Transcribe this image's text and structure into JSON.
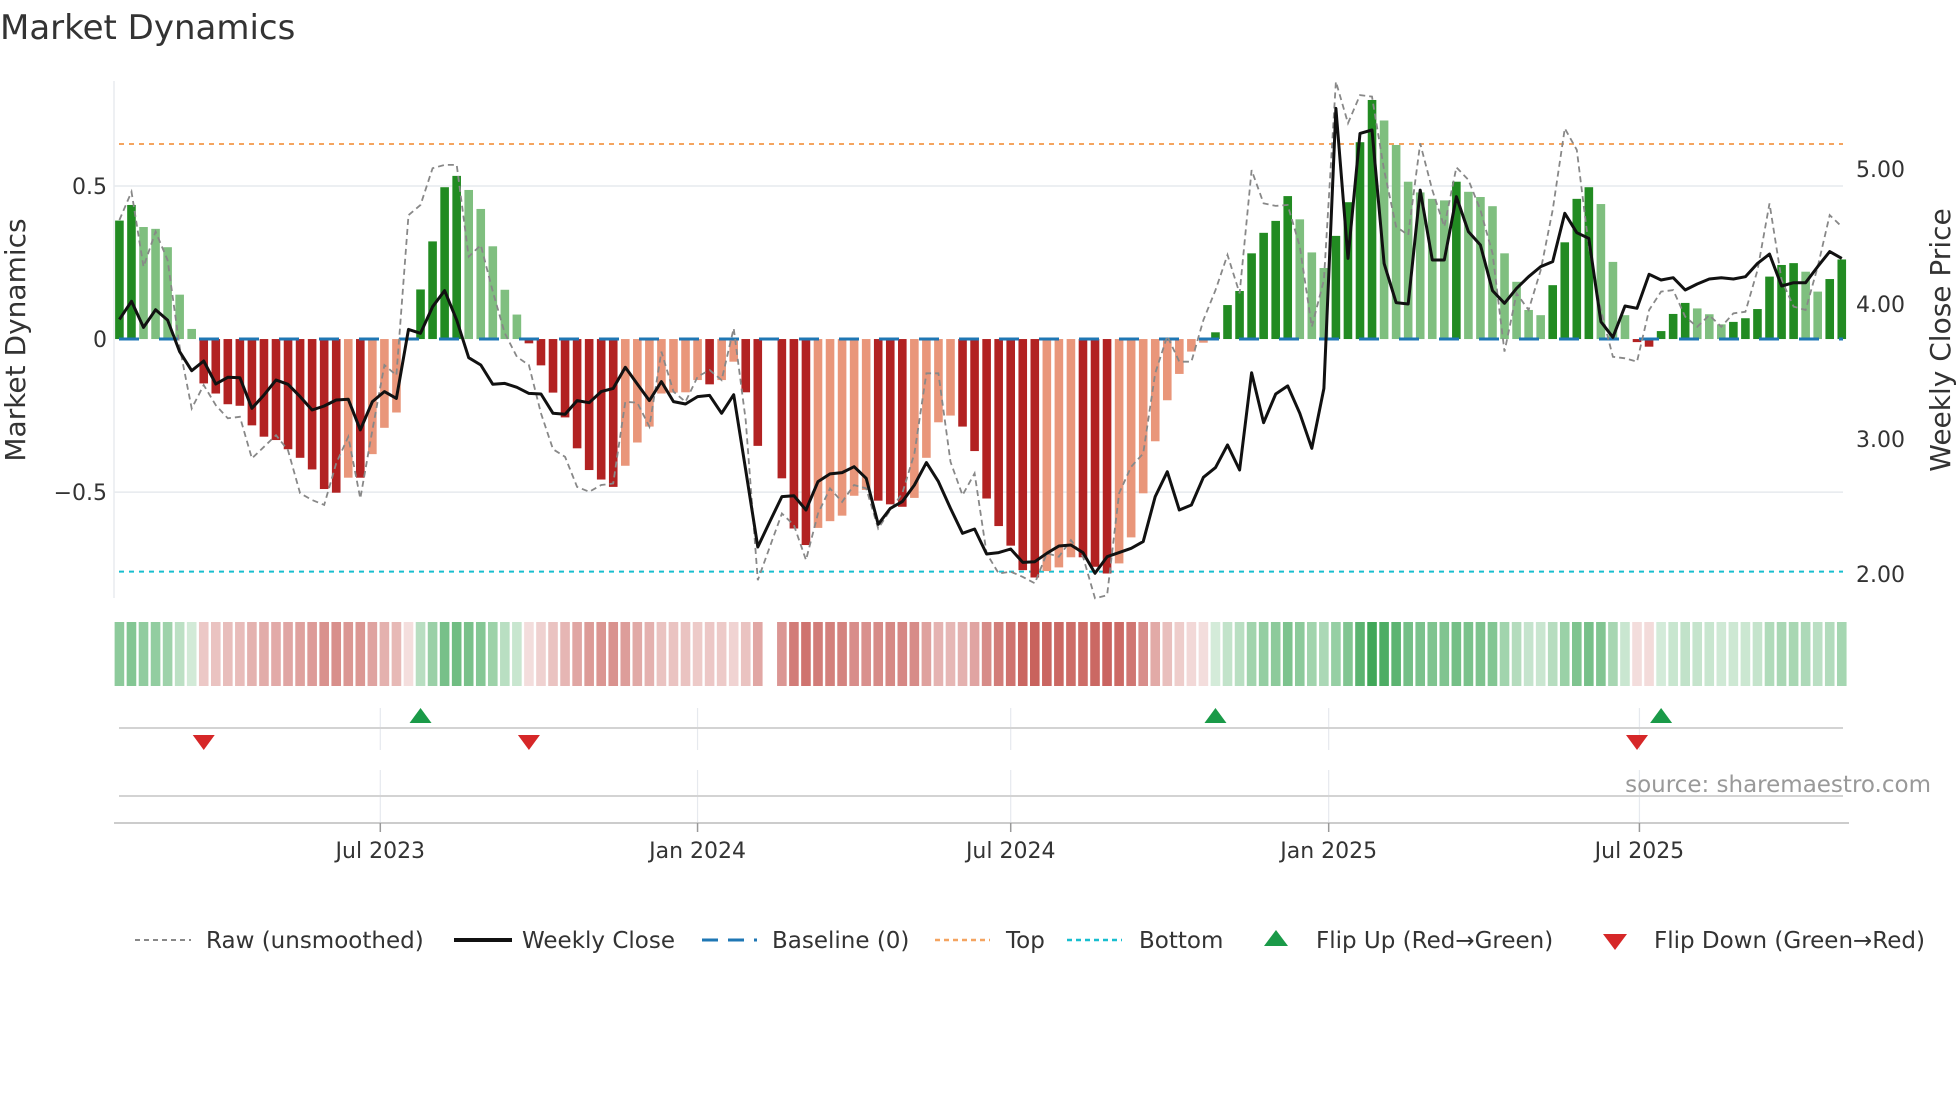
{
  "chart_data": {
    "type": "bar",
    "title": "Market Dynamics",
    "ylabel": "Market Dynamics",
    "ylabel_right": "Weekly Close Price",
    "ylim": [
      -0.846,
      0.843
    ],
    "ylim_right": [
      1.822,
      5.652
    ],
    "xlim_index": [
      -0.45,
      143.6
    ],
    "grid": true,
    "yticks": [
      {
        "v": 0.5,
        "label": "0.5"
      },
      {
        "v": 0,
        "label": "0"
      },
      {
        "v": -0.5,
        "label": "−0.5"
      }
    ],
    "yticks_right": [
      {
        "v": 5,
        "label": "5.00"
      },
      {
        "v": 4,
        "label": "4.00"
      },
      {
        "v": 3,
        "label": "3.00"
      },
      {
        "v": 2,
        "label": "2.00"
      }
    ],
    "xticks": [
      {
        "i": 21.66,
        "label": "Jul 2023"
      },
      {
        "i": 48.0,
        "label": "Jan 2024"
      },
      {
        "i": 74.0,
        "label": "Jul 2024"
      },
      {
        "i": 100.4,
        "label": "Jan 2025"
      },
      {
        "i": 126.2,
        "label": "Jul 2025"
      }
    ],
    "top_level": 0.637,
    "bottom_level": -0.76,
    "baseline": 0,
    "dynamics": [
      0.387,
      0.438,
      0.366,
      0.36,
      0.3,
      0.145,
      0.033,
      -0.145,
      -0.178,
      -0.213,
      -0.218,
      -0.282,
      -0.319,
      -0.33,
      -0.36,
      -0.388,
      -0.426,
      -0.49,
      -0.502,
      -0.453,
      -0.453,
      -0.376,
      -0.29,
      -0.24,
      -0.004,
      0.162,
      0.319,
      0.496,
      0.533,
      0.487,
      0.425,
      0.303,
      0.161,
      0.08,
      -0.014,
      -0.086,
      -0.175,
      -0.256,
      -0.357,
      -0.428,
      -0.459,
      -0.483,
      -0.414,
      -0.338,
      -0.286,
      -0.178,
      -0.175,
      -0.174,
      -0.134,
      -0.148,
      -0.134,
      -0.074,
      -0.174,
      -0.349,
      null,
      -0.455,
      -0.619,
      -0.673,
      -0.617,
      -0.595,
      -0.577,
      -0.512,
      -0.493,
      -0.528,
      -0.54,
      -0.548,
      -0.519,
      -0.388,
      -0.272,
      -0.25,
      -0.286,
      -0.366,
      -0.521,
      -0.611,
      -0.675,
      -0.755,
      -0.779,
      -0.758,
      -0.746,
      -0.713,
      -0.713,
      -0.744,
      -0.766,
      -0.733,
      -0.648,
      -0.504,
      -0.334,
      -0.2,
      -0.114,
      -0.041,
      -0.012,
      0.022,
      0.111,
      0.157,
      0.28,
      0.347,
      0.386,
      0.467,
      0.391,
      0.283,
      0.232,
      0.337,
      0.447,
      0.643,
      0.781,
      0.714,
      0.634,
      0.514,
      0.479,
      0.458,
      0.453,
      0.514,
      0.481,
      0.464,
      0.434,
      0.28,
      0.187,
      0.095,
      0.078,
      0.176,
      0.316,
      0.458,
      0.496,
      0.441,
      0.252,
      0.078,
      -0.01,
      -0.025,
      0.026,
      0.082,
      0.118,
      0.1,
      0.081,
      0.048,
      0.056,
      0.068,
      0.098,
      0.204,
      0.242,
      0.248,
      0.22,
      0.155,
      0.196,
      0.26
    ],
    "raw": [
      0.389,
      0.481,
      0.236,
      0.351,
      0.258,
      -0.025,
      -0.227,
      -0.15,
      -0.216,
      -0.259,
      -0.254,
      -0.39,
      -0.352,
      -0.314,
      -0.363,
      -0.504,
      -0.526,
      -0.542,
      -0.406,
      -0.319,
      -0.521,
      -0.297,
      -0.085,
      -0.118,
      0.405,
      0.438,
      0.558,
      0.569,
      0.569,
      0.269,
      0.307,
      0.155,
      0.019,
      -0.058,
      -0.085,
      -0.243,
      -0.36,
      -0.385,
      -0.483,
      -0.499,
      -0.477,
      -0.472,
      -0.205,
      -0.208,
      -0.286,
      -0.041,
      -0.172,
      -0.205,
      -0.123,
      -0.101,
      -0.134,
      0.035,
      -0.265,
      -0.788,
      -0.679,
      -0.57,
      -0.608,
      -0.722,
      -0.57,
      -0.488,
      -0.532,
      -0.477,
      -0.488,
      -0.619,
      -0.559,
      -0.504,
      -0.374,
      -0.112,
      -0.112,
      -0.401,
      -0.51,
      -0.439,
      -0.7,
      -0.766,
      -0.76,
      -0.777,
      -0.798,
      -0.7,
      -0.711,
      -0.657,
      -0.711,
      -0.847,
      -0.837,
      -0.504,
      -0.417,
      -0.374,
      -0.112,
      0.01,
      -0.074,
      -0.074,
      0.062,
      0.16,
      0.275,
      0.149,
      0.552,
      0.443,
      0.435,
      0.438,
      0.302,
      0.04,
      0.193,
      0.841,
      0.705,
      0.797,
      0.792,
      0.552,
      0.367,
      0.34,
      0.639,
      0.487,
      0.367,
      0.561,
      0.52,
      0.422,
      0.28,
      -0.041,
      0.149,
      0.095,
      0.225,
      0.422,
      0.688,
      0.618,
      0.302,
      0.095,
      -0.058,
      -0.063,
      -0.074,
      0.095,
      0.155,
      0.16,
      0.073,
      0.04,
      0.078,
      0.04,
      0.084,
      0.089,
      0.225,
      0.443,
      0.193,
      0.106,
      0.095,
      0.236,
      0.405,
      0.367
    ],
    "weekly_close": [
      3.886,
      4.02,
      3.827,
      3.958,
      3.881,
      3.647,
      3.506,
      3.578,
      3.407,
      3.457,
      3.454,
      3.227,
      3.326,
      3.437,
      3.405,
      3.314,
      3.215,
      3.244,
      3.289,
      3.294,
      3.067,
      3.277,
      3.351,
      3.301,
      3.812,
      3.783,
      3.98,
      4.099,
      3.881,
      3.602,
      3.548,
      3.405,
      3.412,
      3.383,
      3.338,
      3.333,
      3.19,
      3.183,
      3.284,
      3.269,
      3.351,
      3.375,
      3.531,
      3.407,
      3.284,
      3.425,
      3.277,
      3.259,
      3.314,
      3.323,
      3.19,
      3.328,
      2.77,
      2.2,
      2.388,
      2.573,
      2.58,
      2.474,
      2.684,
      2.741,
      2.751,
      2.795,
      2.709,
      2.368,
      2.486,
      2.536,
      2.659,
      2.825,
      2.684,
      2.486,
      2.301,
      2.333,
      2.148,
      2.158,
      2.185,
      2.086,
      2.091,
      2.153,
      2.207,
      2.215,
      2.158,
      2.005,
      2.128,
      2.158,
      2.19,
      2.24,
      2.573,
      2.758,
      2.474,
      2.511,
      2.716,
      2.788,
      2.956,
      2.77,
      3.491,
      3.121,
      3.333,
      3.393,
      3.19,
      2.931,
      3.375,
      5.449,
      4.338,
      5.264,
      5.289,
      4.301,
      4.01,
      4.0,
      4.844,
      4.326,
      4.326,
      4.795,
      4.536,
      4.437,
      4.099,
      4.005,
      4.116,
      4.202,
      4.277,
      4.314,
      4.672,
      4.528,
      4.486,
      3.869,
      3.753,
      3.985,
      3.968,
      4.22,
      4.178,
      4.195,
      4.104,
      4.148,
      4.185,
      4.195,
      4.185,
      4.202,
      4.301,
      4.37,
      4.133,
      4.158,
      4.158,
      4.277,
      4.388,
      4.338
    ],
    "flips": {
      "up": [
        25,
        91,
        128
      ],
      "down": [
        7,
        34,
        126
      ]
    },
    "legend": {
      "placement": "bottom",
      "raw": "Raw (unsmoothed)",
      "close": "Weekly Close",
      "baseline": "Baseline (0)",
      "top": "Top",
      "bottom": "Bottom",
      "flip_up": "Flip Up (Red→Green)",
      "flip_down": "Flip Down (Green→Red)"
    },
    "source": "source: sharemaestro.com",
    "colors": {
      "up_strong": "#228b22",
      "up_weak": "#7fbf7f",
      "down_strong": "#b22222",
      "down_weak": "#e9967a",
      "close": "#111111",
      "raw": "#888888",
      "baseline": "#1f77b4",
      "top": "#f4a460",
      "bottom": "#17becf",
      "flip_up": "#1a9a48",
      "flip_down": "#d62728"
    }
  }
}
